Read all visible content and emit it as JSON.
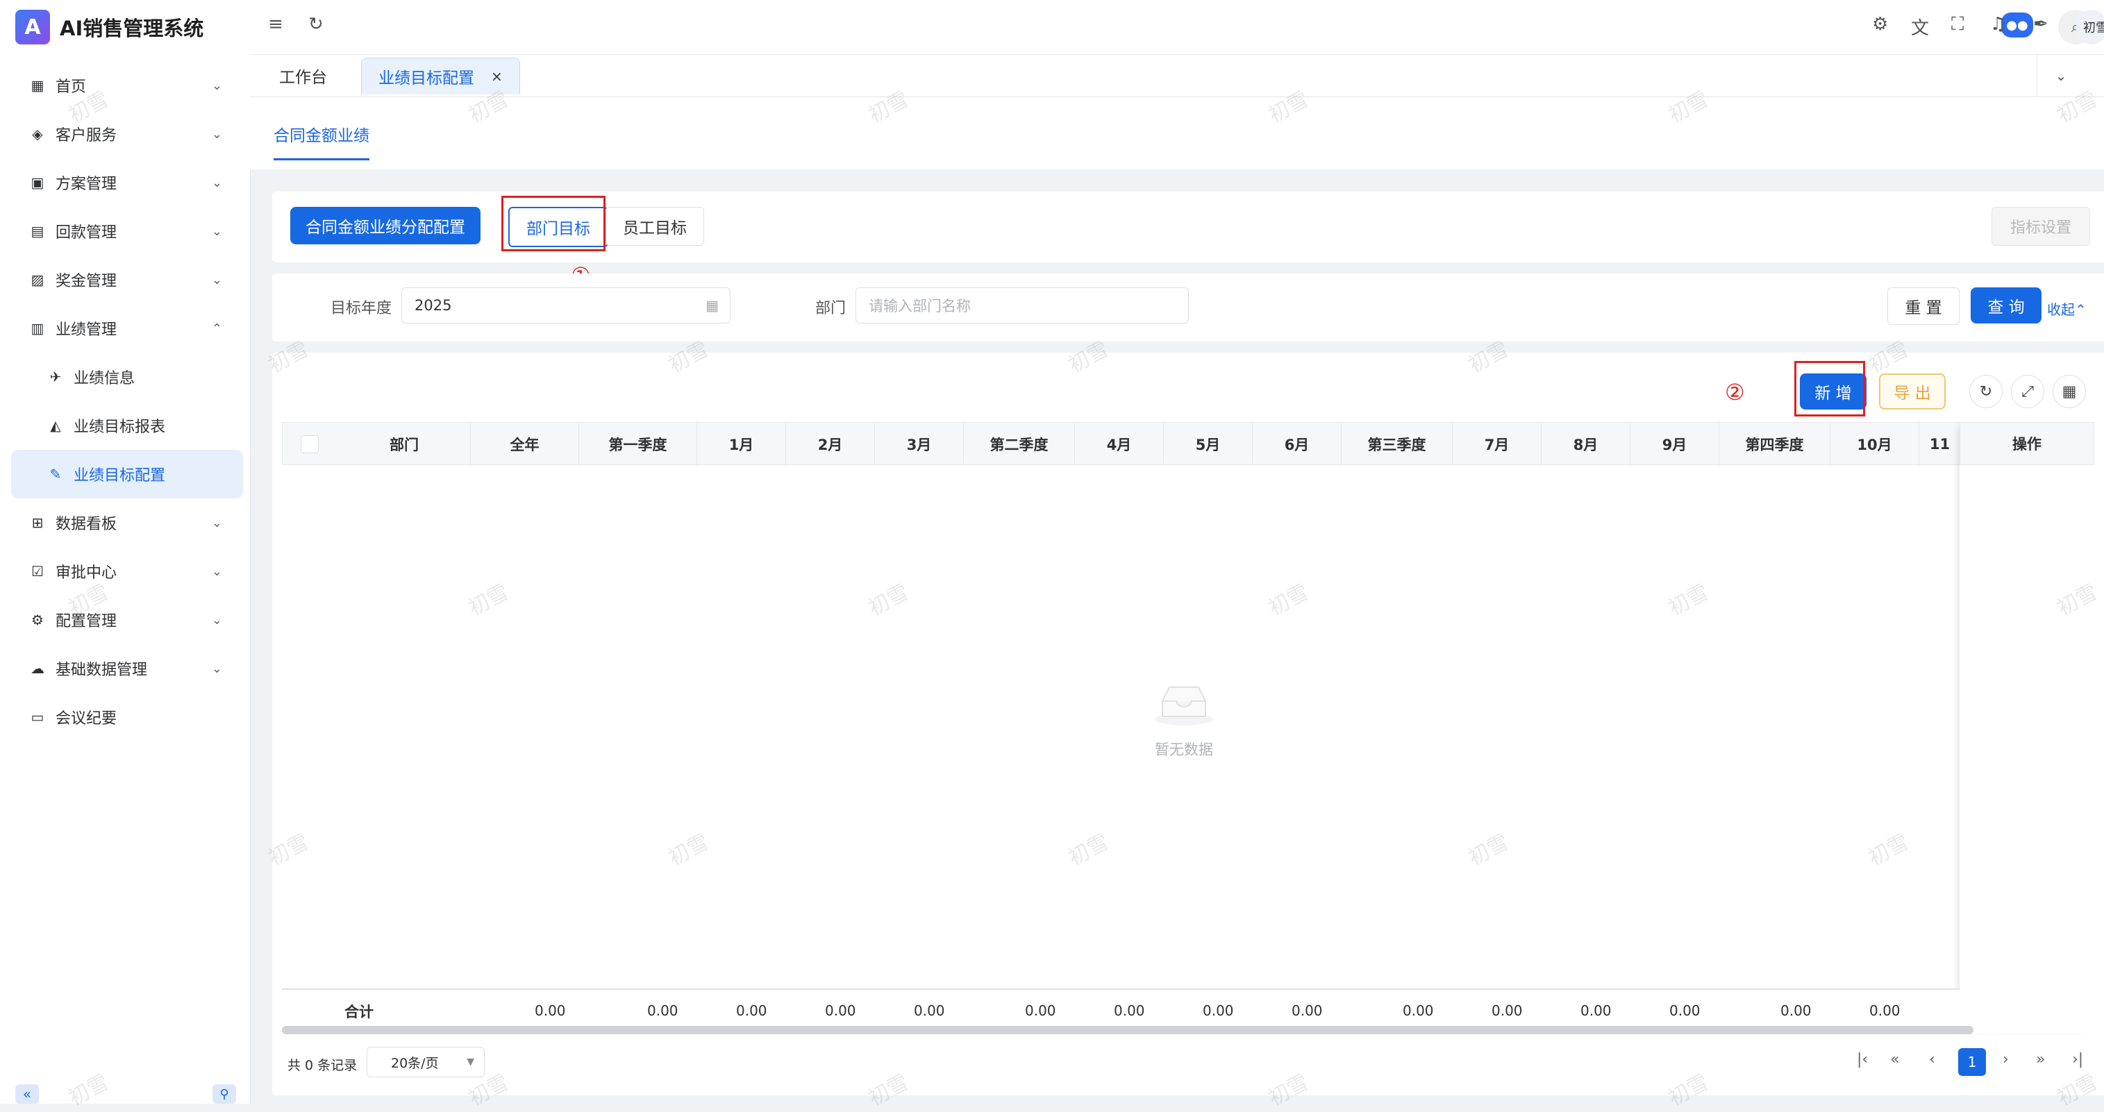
{
  "app": {
    "title": "AI销售管理系统",
    "logo_text": "A"
  },
  "sidebar": {
    "items": [
      {
        "label": "首页",
        "icon": "dashboard-icon",
        "glyph": "▦",
        "expand": "⌄"
      },
      {
        "label": "客户服务",
        "icon": "customer-service-icon",
        "glyph": "◈",
        "expand": "⌄"
      },
      {
        "label": "方案管理",
        "icon": "plan-icon",
        "glyph": "▣",
        "expand": "⌄"
      },
      {
        "label": "回款管理",
        "icon": "payment-icon",
        "glyph": "▤",
        "expand": "⌄"
      },
      {
        "label": "奖金管理",
        "icon": "bonus-icon",
        "glyph": "▨",
        "expand": "⌄"
      },
      {
        "label": "业绩管理",
        "icon": "performance-chart-icon",
        "glyph": "▥",
        "expand": "⌃"
      },
      {
        "label": "业绩信息",
        "icon": "rocket-icon",
        "glyph": "✈",
        "expand": ""
      },
      {
        "label": "业绩目标报表",
        "icon": "area-chart-icon",
        "glyph": "◭",
        "expand": ""
      },
      {
        "label": "业绩目标配置",
        "icon": "edit-pen-icon",
        "glyph": "✎",
        "expand": ""
      },
      {
        "label": "数据看板",
        "icon": "grid-icon",
        "glyph": "⊞",
        "expand": "⌄"
      },
      {
        "label": "审批中心",
        "icon": "approval-icon",
        "glyph": "☑",
        "expand": "⌄"
      },
      {
        "label": "配置管理",
        "icon": "settings-icon",
        "glyph": "⚙",
        "expand": "⌄"
      },
      {
        "label": "基础数据管理",
        "icon": "cloud-data-icon",
        "glyph": "☁",
        "expand": "⌄"
      },
      {
        "label": "会议纪要",
        "icon": "meeting-icon",
        "glyph": "▭",
        "expand": ""
      }
    ],
    "collapse_glyph": "«",
    "pin_glyph": "⚲"
  },
  "topbar": {
    "menu_glyph": "≡",
    "refresh_glyph": "↻",
    "robot_glyph": "●●",
    "search_glyph": "⌕",
    "settings_glyph": "⚙",
    "translate_glyph": "文",
    "fullscreen_glyph": "⛶",
    "bell_glyph": "♫",
    "wrench_glyph": "✒",
    "user_name": "初雪"
  },
  "tabs": [
    {
      "label": "工作台"
    },
    {
      "label": "业绩目标配置",
      "close": "×"
    }
  ],
  "tab_dropdown_glyph": "⌄",
  "subtab": {
    "label": "合同金额业绩"
  },
  "actions": {
    "primary_label": "合同金额业绩分配配置",
    "seg_dept": "部门目标",
    "seg_staff": "员工目标",
    "indicator_setting": "指标设置",
    "annotation_1": "①",
    "annotation_2": "②"
  },
  "filter": {
    "year_label": "目标年度",
    "year_value": "2025",
    "dept_label": "部门",
    "dept_placeholder": "请输入部门名称",
    "reset_label": "重 置",
    "query_label": "查 询",
    "collapse_label": "收起⌃",
    "calendar_glyph": "▦"
  },
  "toolbar": {
    "add_label": "新 增",
    "export_label": "导 出",
    "refresh_glyph": "↻",
    "fullscreen_glyph": "⤢",
    "columns_glyph": "▦"
  },
  "table": {
    "columns": [
      "部门",
      "全年",
      "第一季度",
      "1月",
      "2月",
      "3月",
      "第二季度",
      "4月",
      "5月",
      "6月",
      "第三季度",
      "7月",
      "8月",
      "9月",
      "第四季度",
      "10月",
      "11"
    ],
    "op_column": "操作",
    "empty_text": "暂无数据",
    "sum_label": "合计",
    "sum_values": [
      "0.00",
      "0.00",
      "0.00",
      "0.00",
      "0.00",
      "0.00",
      "0.00",
      "0.00",
      "0.00",
      "0.00",
      "0.00",
      "0.00",
      "0.00",
      "0.00",
      "0.00"
    ]
  },
  "pager": {
    "total_text": "共 0 条记录",
    "size_text": "20条/页",
    "current": "1",
    "first_glyph": "|‹",
    "prev_fast_glyph": "«",
    "prev_glyph": "‹",
    "next_glyph": "›",
    "next_fast_glyph": "»",
    "last_glyph": "›|"
  },
  "watermark": "初雪"
}
